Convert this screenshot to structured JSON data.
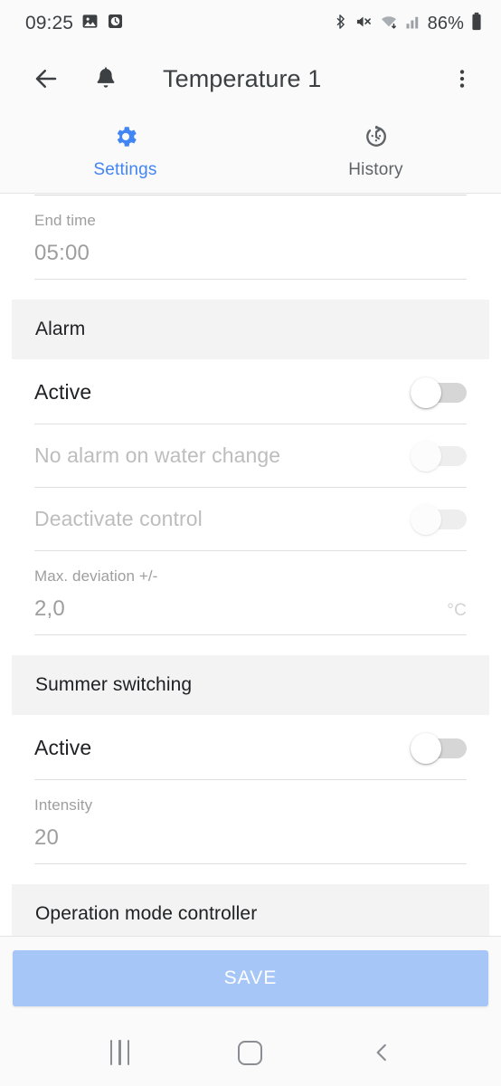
{
  "status_bar": {
    "time": "09:25",
    "battery_percent": "86%",
    "left_icons": [
      "gallery-icon",
      "alarm-clock-icon"
    ],
    "right_icons": [
      "bluetooth-icon",
      "volume-muted-icon",
      "wifi-icon",
      "cellular-signal-icon",
      "battery-icon"
    ]
  },
  "app_bar": {
    "back_icon": "back-arrow-icon",
    "bell_icon": "bell-icon",
    "title": "Temperature 1",
    "overflow_icon": "more-vertical-icon"
  },
  "tabs": [
    {
      "label": "Settings",
      "icon": "gear-icon",
      "active": true
    },
    {
      "label": "History",
      "icon": "history-icon",
      "active": false
    }
  ],
  "colors": {
    "accent": "#4285f4",
    "save_button_bg": "#a7c6f8",
    "section_header_bg": "#f3f3f3",
    "disabled_text": "#bdbdbd",
    "muted_text": "#9e9e9e"
  },
  "settings": {
    "end_time": {
      "label": "End time",
      "value": "05:00",
      "suffix": ""
    },
    "alarm": {
      "header": "Alarm",
      "rows": [
        {
          "label": "Active",
          "toggle": "off",
          "disabled": false
        },
        {
          "label": "No alarm on water change",
          "toggle": "off",
          "disabled": true
        },
        {
          "label": "Deactivate control",
          "toggle": "off",
          "disabled": true
        }
      ],
      "max_deviation": {
        "label": "Max. deviation +/-",
        "value": "2,0",
        "suffix": "°C"
      }
    },
    "summer_switching": {
      "header": "Summer switching",
      "rows": [
        {
          "label": "Active",
          "toggle": "off",
          "disabled": false
        }
      ],
      "intensity": {
        "label": "Intensity",
        "value": "20",
        "suffix": ""
      }
    },
    "operation_mode": {
      "header": "Operation mode controller"
    }
  },
  "save_bar": {
    "save_label": "SAVE"
  },
  "nav_bar": {
    "recents_icon": "recents-icon",
    "home_icon": "home-icon",
    "back_icon": "nav-back-icon"
  }
}
